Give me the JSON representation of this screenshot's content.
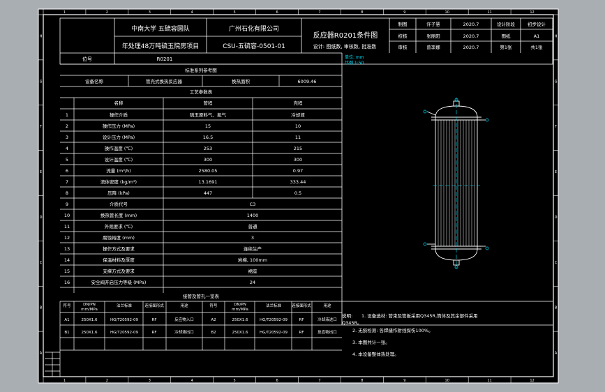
{
  "sheet": {
    "background": "#a9aeb3",
    "paper": "#000000",
    "line_color": "#ffffff",
    "accent": "#00e5ff",
    "top_numbers": [
      "1",
      "2",
      "3",
      "4",
      "5",
      "6",
      "7",
      "8",
      "9",
      "10",
      "11",
      "12"
    ],
    "bottom_numbers": [
      "1",
      "2",
      "3",
      "4",
      "5",
      "6",
      "7",
      "8",
      "9",
      "10",
      "11",
      "12"
    ],
    "side_letters": [
      "A",
      "B",
      "C",
      "D",
      "E",
      "F",
      "G",
      "H"
    ]
  },
  "title_block": {
    "university": "中南大学 五硫容圆队",
    "project": "年处理48万吨硫玉院房项目",
    "company": "广州石化有限公司",
    "drawing_no": "CSU-五硫容-0501-01",
    "stage": "设计: 图纸数, 审核数, 批准数",
    "drawing_title": "反应器R0201条件图",
    "sign_rows": [
      [
        "制图",
        "许子慧",
        "2020.7",
        "设计阶段",
        "初步设计"
      ],
      [
        "校核",
        "张丽阳",
        "2020.7",
        "图纸",
        "A1"
      ],
      [
        "审核",
        "曾李娜",
        "2020.7",
        "第1张",
        "共1张"
      ]
    ],
    "tag_label": "位号",
    "tag_value": "R0201"
  },
  "spec_table": {
    "section_title": "标准系列参考图",
    "equip_label": "设备名称",
    "equip_name": "管壳式换热反应器",
    "area_label": "换热面积",
    "area_value": "6009.46",
    "params_title": "工艺参数表",
    "headers": [
      "名称",
      "管程",
      "壳程"
    ],
    "rows": [
      [
        "1",
        "操作介质",
        "硫玉原料气、氮气",
        "冷却液"
      ],
      [
        "2",
        "操作压力 (MPa)",
        "15",
        "10"
      ],
      [
        "3",
        "设计压力 (MPa)",
        "16.5",
        "11"
      ],
      [
        "4",
        "操作温度 (℃)",
        "253",
        "215"
      ],
      [
        "5",
        "设计温度 (℃)",
        "300",
        "300"
      ],
      [
        "6",
        "流量 (m³/h)",
        "2580.05",
        "0.97"
      ],
      [
        "7",
        "流体密度 (kg/m³)",
        "13.1691",
        "333.44"
      ],
      [
        "8",
        "压降 (kPa)",
        "447",
        "0.5"
      ]
    ],
    "merged_rows": [
      [
        "9",
        "介质代号",
        "C3"
      ],
      [
        "10",
        "换热管长度 (mm)",
        "1400"
      ],
      [
        "11",
        "外观要求 (℃)",
        "普通"
      ],
      [
        "12",
        "腐蚀裕度 (mm)",
        "3"
      ],
      [
        "13",
        "操作方式及要求",
        "连续生产"
      ],
      [
        "14",
        "保温材料及厚度",
        "岩棉, 100mm"
      ],
      [
        "15",
        "支撑方式及要求",
        "裙座"
      ],
      [
        "16",
        "安全阀开启压力等级 (MPa)",
        "24"
      ]
    ]
  },
  "nozzle_table": {
    "title": "接管及管孔一览表",
    "headers": [
      "符号",
      "DN/PN\nmm/MPa",
      "法兰标准",
      "连接面形式",
      "用途"
    ],
    "rows": [
      [
        "A1",
        "250X1.6",
        "HG/T20592-09",
        "RF",
        "反应物入口"
      ],
      [
        "B1",
        "250X1.6",
        "HG/T20592-09",
        "RF",
        "冷却液出口"
      ]
    ],
    "rows_right": [
      [
        "A2",
        "250X1.6",
        "HG/T20592-09",
        "RF",
        "冷却液进口"
      ],
      [
        "B2",
        "250X1.6",
        "HG/T20592-09",
        "RF",
        "反应物出口"
      ]
    ]
  },
  "notes": {
    "label": "说明:",
    "items": [
      "1. 设备选材: 管束及管板采用Q345R,筒体及其余部件采用",
      "Q345R。",
      "2. 无损检测: 各焊缝作射线探伤100%。",
      "3. 本图共计一张。",
      "4. 本设备整体热处理。"
    ]
  },
  "drawing": {
    "scale_label_1": "单位: mm",
    "scale_label_2": "比例 1:50",
    "tube_count": 14
  }
}
